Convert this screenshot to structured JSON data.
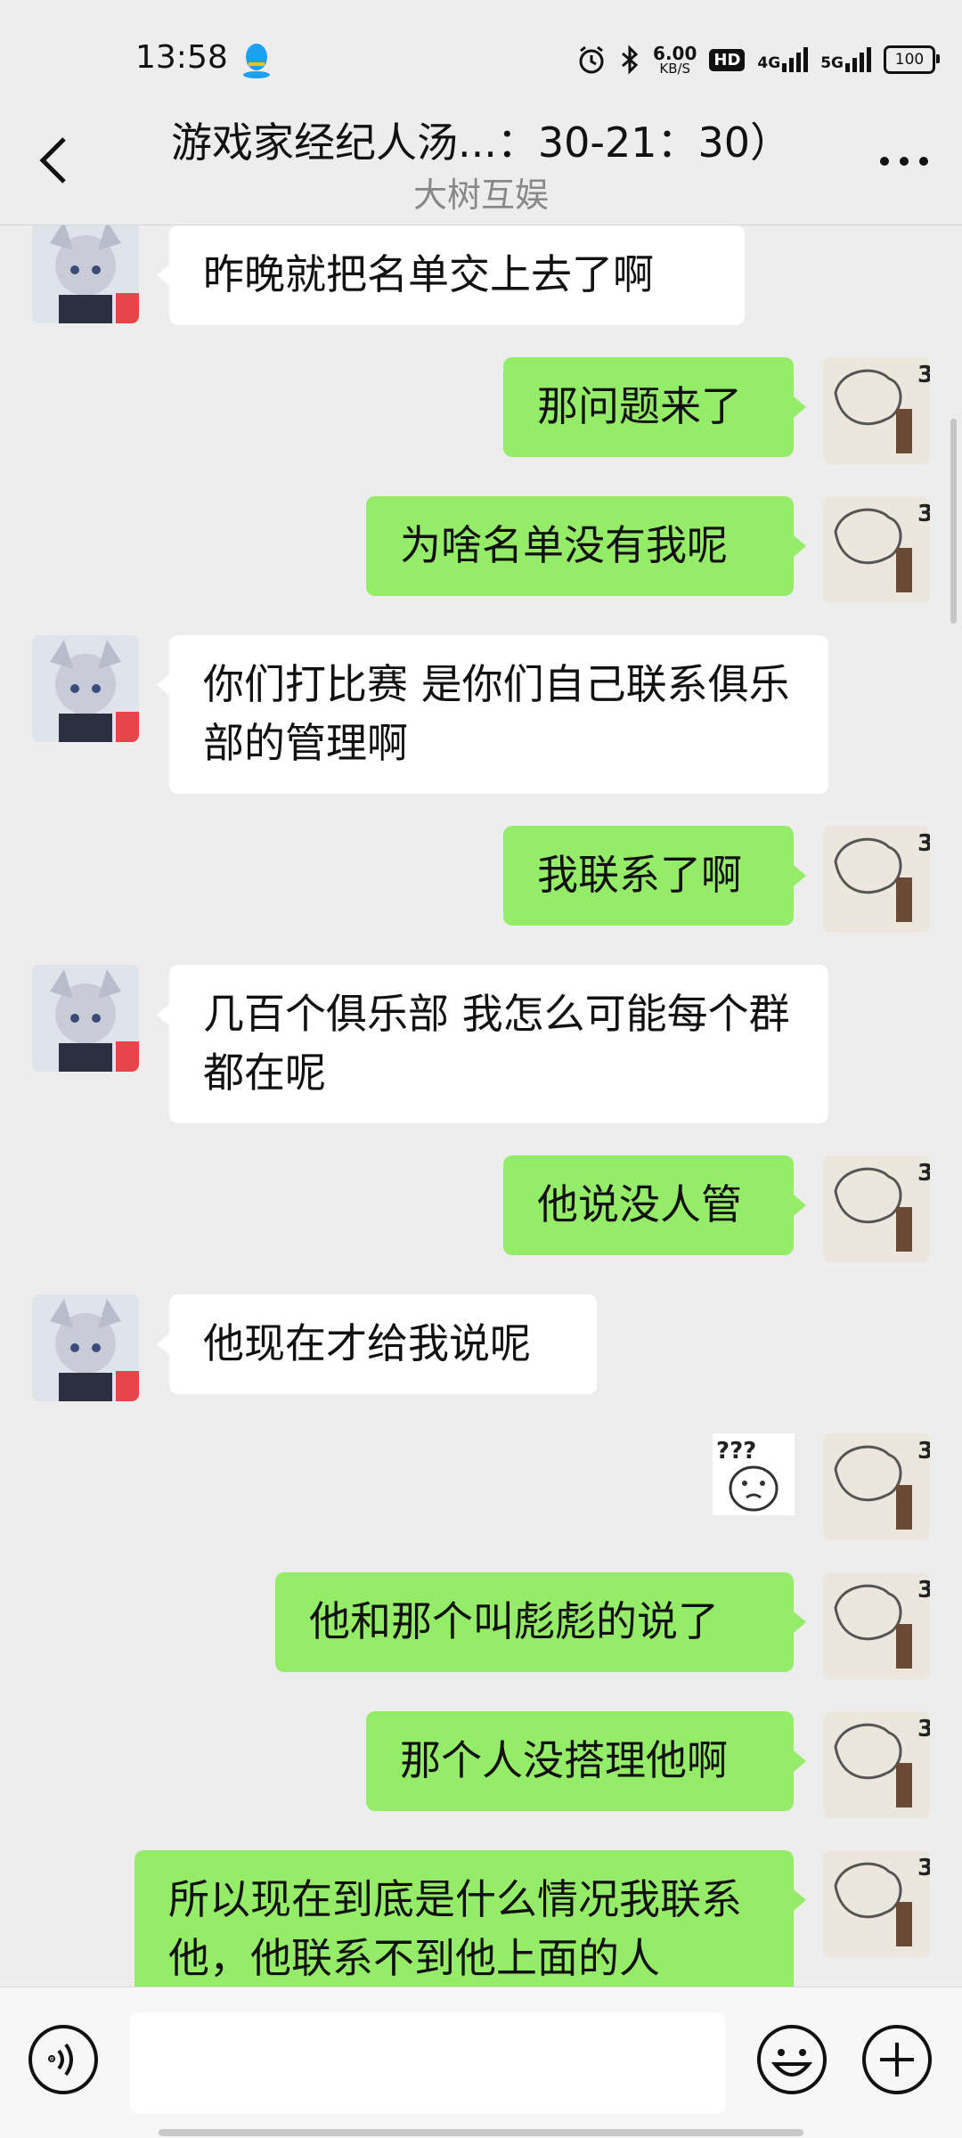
{
  "status_bar": {
    "time": "13:58",
    "net_speed_value": "6.00",
    "net_speed_unit": "KB/S",
    "hd_label": "HD",
    "network_1": "4G",
    "network_2": "5G",
    "battery": "100"
  },
  "header": {
    "title": "游戏家经纪人汤...：30-21：30）",
    "subtitle": "大树互娱"
  },
  "messages": [
    {
      "side": "left",
      "text": "昨晚就把名单交上去了啊"
    },
    {
      "side": "right",
      "text": "那问题来了"
    },
    {
      "side": "right",
      "text": "为啥名单没有我呢"
    },
    {
      "side": "left",
      "text": "你们打比赛 是你们自己联系俱乐部的管理啊"
    },
    {
      "side": "right",
      "text": "我联系了啊"
    },
    {
      "side": "left",
      "text": "几百个俱乐部 我怎么可能每个群都在呢"
    },
    {
      "side": "right",
      "text": "他说没人管"
    },
    {
      "side": "left",
      "text": "他现在才给我说呢"
    },
    {
      "side": "right",
      "sticker": "confused-sticker",
      "sticker_text": "???"
    },
    {
      "side": "right",
      "text": "他和那个叫彪彪的说了"
    },
    {
      "side": "right",
      "text": "那个人没搭理他啊"
    },
    {
      "side": "right",
      "text": "所以现在到底是什么情况我联系他，他联系不到他上面的人"
    }
  ],
  "icons": {
    "back": "chevron-left-icon",
    "more": "more-dots-icon",
    "voice": "voice-icon",
    "emoji": "emoji-icon",
    "plus": "plus-icon"
  },
  "colors": {
    "background": "#ededed",
    "bubble_right": "#95ec69",
    "bubble_left": "#ffffff"
  }
}
